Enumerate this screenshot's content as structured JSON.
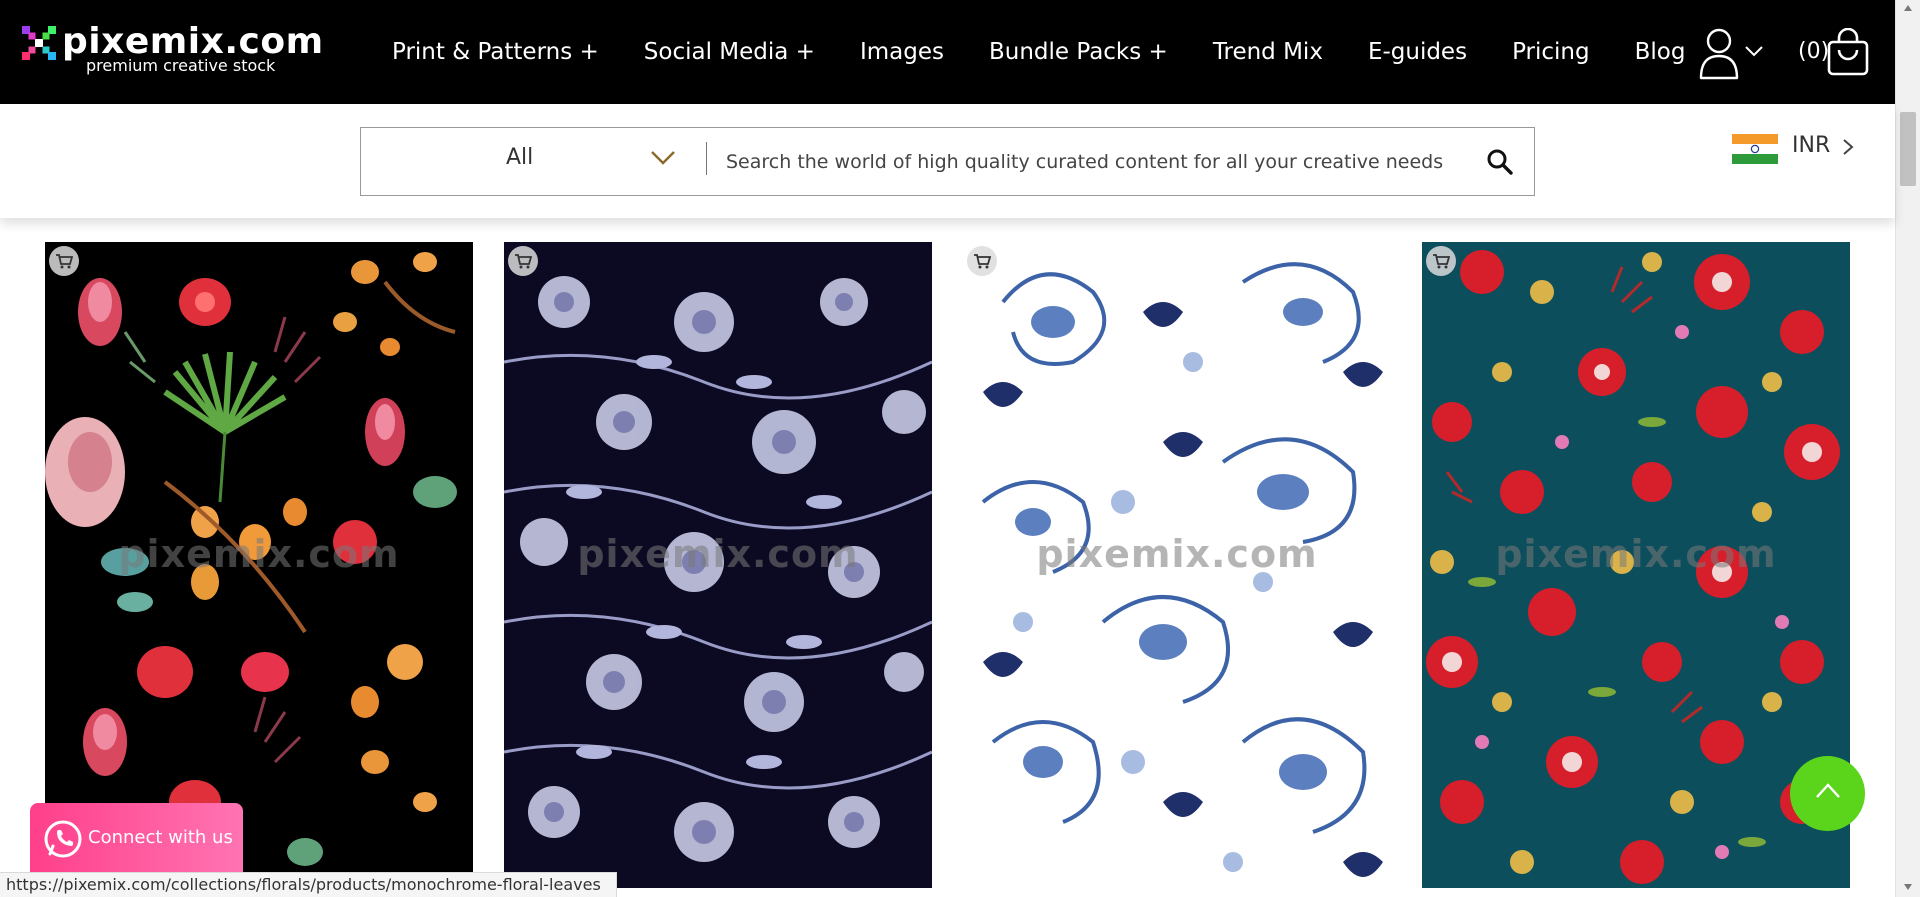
{
  "brand": {
    "name": "pixemix.com",
    "tagline": "premium creative stock"
  },
  "nav": {
    "items": [
      {
        "label": "Print & Patterns +"
      },
      {
        "label": "Social Media +"
      },
      {
        "label": "Images"
      },
      {
        "label": "Bundle Packs +"
      },
      {
        "label": "Trend Mix"
      },
      {
        "label": "E-guides"
      },
      {
        "label": "Pricing"
      },
      {
        "label": "Blog"
      }
    ],
    "cart_count": "(0)"
  },
  "search": {
    "category": "All",
    "placeholder": "Search the world of high quality curated content for all your creative needs"
  },
  "currency": {
    "code": "INR"
  },
  "products": [
    {
      "watermark": "pixemix.com",
      "bg": "#000000"
    },
    {
      "watermark": "pixemix.com",
      "bg": "#0c0a22"
    },
    {
      "watermark": "pixemix.com",
      "bg": "#ffffff"
    },
    {
      "watermark": "pixemix.com",
      "bg": "#0d4e5c"
    }
  ],
  "floating": {
    "connect_label": "Connect with us"
  },
  "status_url": "https://pixemix.com/collections/florals/products/monochrome-floral-leaves",
  "colors": {
    "header_bg": "#000000",
    "accent_green": "#5ad51c",
    "connect_pink": "#ff4f95"
  }
}
